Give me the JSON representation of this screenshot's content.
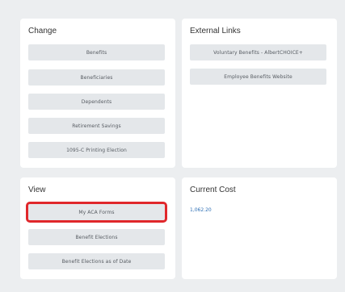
{
  "change": {
    "title": "Change",
    "buttons": [
      {
        "label": "Benefits"
      },
      {
        "label": "Beneficiaries"
      },
      {
        "label": "Dependents"
      },
      {
        "label": "Retirement Savings"
      },
      {
        "label": "1095-C Printing Election"
      }
    ]
  },
  "external_links": {
    "title": "External Links",
    "buttons": [
      {
        "label": "Voluntary Benefits - AlbertCHOICE+"
      },
      {
        "label": "Employee Benefits Website"
      }
    ]
  },
  "view": {
    "title": "View",
    "buttons": [
      {
        "label": "My ACA Forms"
      },
      {
        "label": "Benefit Elections"
      },
      {
        "label": "Benefit Elections as of Date"
      }
    ]
  },
  "current_cost": {
    "title": "Current Cost",
    "amount": "1,062.20"
  },
  "colors": {
    "background": "#eceef0",
    "card": "#ffffff",
    "button": "#e4e7ea",
    "highlight": "#e0272b",
    "link": "#2e6fb5"
  }
}
